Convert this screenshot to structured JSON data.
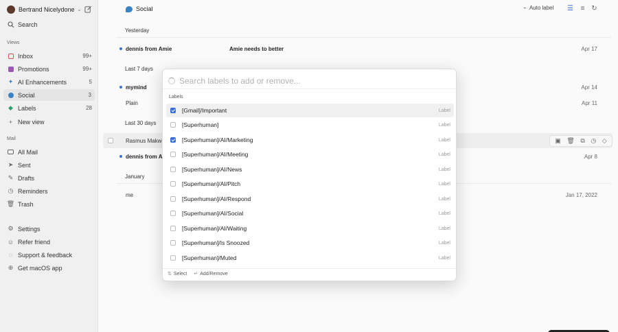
{
  "sidebar": {
    "account_name": "Bertrand Nicelydone",
    "search_label": "Search",
    "views_title": "Views",
    "views": [
      {
        "label": "Inbox",
        "count": "99+",
        "color": "#d9534f"
      },
      {
        "label": "Promotions",
        "count": "99+",
        "color": "#9b59b6"
      },
      {
        "label": "AI Enhancements",
        "count": "5",
        "color": "#3b82c4"
      },
      {
        "label": "Social",
        "count": "3",
        "color": "#3b82c4"
      },
      {
        "label": "Labels",
        "count": "28",
        "color": "#2e9e6b"
      }
    ],
    "new_view_label": "New view",
    "mail_title": "Mail",
    "mail_items": [
      "All Mail",
      "Sent",
      "Drafts",
      "Reminders",
      "Trash"
    ],
    "bottom_items": [
      "Settings",
      "Refer friend",
      "Support & feedback",
      "Get macOS app"
    ]
  },
  "header": {
    "title": "Social",
    "auto_label": "Auto label"
  },
  "groups": [
    "Yesterday",
    "Last 7 days",
    "Last 30 days",
    "January"
  ],
  "rows": [
    {
      "from": "dennis from Amie",
      "subject": "Amie needs to better",
      "date": "Apr 17"
    },
    {
      "from": "mymind",
      "subject": "",
      "date": "Apr 14"
    },
    {
      "from": "Plain",
      "subject": "",
      "date": "Apr 11"
    },
    {
      "from": "Rasmus Makwa",
      "subject": "",
      "date": ""
    },
    {
      "from": "dennis from A",
      "subject": "",
      "date": "Apr 8"
    },
    {
      "from": "me",
      "subject": "",
      "date": "Jan 17, 2022"
    }
  ],
  "modal": {
    "placeholder": "Search labels to add or remove...",
    "section_title": "Labels",
    "labels": [
      {
        "name": "[Gmail]/Important",
        "kind": "Label",
        "checked": true
      },
      {
        "name": "[Superhuman]",
        "kind": "Label",
        "checked": false
      },
      {
        "name": "[Superhuman]/AI/Marketing",
        "kind": "Label",
        "checked": true
      },
      {
        "name": "[Superhuman]/AI/Meeting",
        "kind": "Label",
        "checked": false
      },
      {
        "name": "[Superhuman]/AI/News",
        "kind": "Label",
        "checked": false
      },
      {
        "name": "[Superhuman]/AI/Pitch",
        "kind": "Label",
        "checked": false
      },
      {
        "name": "[Superhuman]/AI/Respond",
        "kind": "Label",
        "checked": false
      },
      {
        "name": "[Superhuman]/AI/Social",
        "kind": "Label",
        "checked": false
      },
      {
        "name": "[Superhuman]/AI/Waiting",
        "kind": "Label",
        "checked": false
      },
      {
        "name": "[Superhuman]/Is Snoozed",
        "kind": "Label",
        "checked": false
      },
      {
        "name": "[Superhuman]/Muted",
        "kind": "Label",
        "checked": false
      }
    ],
    "footer_select_key": "⇅",
    "footer_select": "Select",
    "footer_add_key": "↵",
    "footer_add": "Add/Remove"
  }
}
